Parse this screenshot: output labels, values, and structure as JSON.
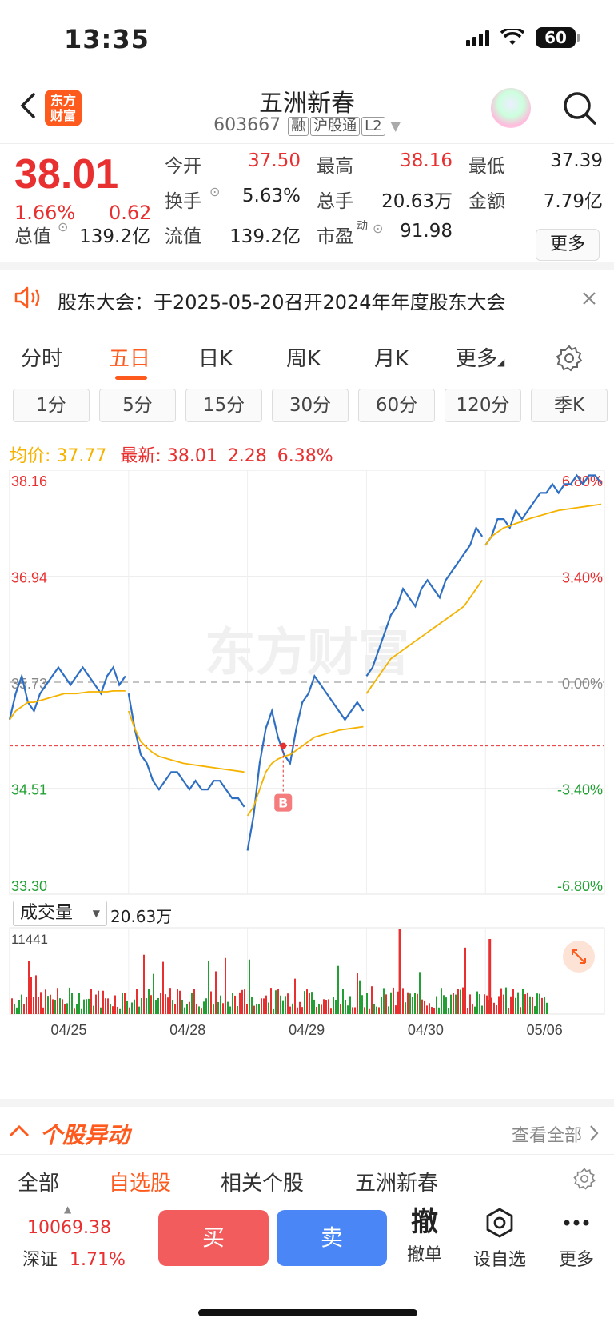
{
  "status": {
    "time": "13:35",
    "battery": "60"
  },
  "header": {
    "title": "五洲新春",
    "code": "603667",
    "tags": [
      "融",
      "沪股通",
      "L2"
    ],
    "logo_text": "东方财富"
  },
  "quote": {
    "price": "38.01",
    "pct": "1.66%",
    "change": "0.62",
    "open_label": "今开",
    "open": "37.50",
    "high_label": "最高",
    "high": "38.16",
    "low_label": "最低",
    "low": "37.39",
    "turnover_label": "换手",
    "turnover": "5.63%",
    "volume_label": "总手",
    "volume": "20.63万",
    "amount_label": "金额",
    "amount": "7.79亿",
    "mktcap_label": "总值",
    "mktcap": "139.2亿",
    "float_label": "流值",
    "float": "139.2亿",
    "pe_label": "市盈",
    "pe_sup": "动",
    "pe": "91.98",
    "more": "更多"
  },
  "notice": {
    "text": "股东大会：于2025-05-20召开2024年年度股东大会"
  },
  "tabs": [
    "分时",
    "五日",
    "日K",
    "周K",
    "月K",
    "更多"
  ],
  "subtabs": [
    "1分",
    "5分",
    "15分",
    "30分",
    "60分",
    "120分",
    "季K"
  ],
  "info": {
    "avg_label": "均价:",
    "avg": "37.77",
    "latest_label": "最新:",
    "latest": "38.01",
    "chg": "2.28",
    "pct": "6.38%"
  },
  "volume_panel": {
    "label": "成交量",
    "value": "20.63万",
    "max_label": "11441"
  },
  "chart_data": {
    "type": "line",
    "x": [
      "04/25",
      "04/28",
      "04/29",
      "04/30",
      "05/06"
    ],
    "y_labels_left": [
      "38.16",
      "36.94",
      "35.73",
      "34.51",
      "33.30"
    ],
    "y_labels_right": [
      "6.80%",
      "3.40%",
      "0.00%",
      "-3.40%",
      "-6.80%"
    ],
    "ylim": [
      33.3,
      38.16
    ],
    "prev_close": 35.73,
    "current_line": 35.0,
    "marker": "B",
    "series": [
      {
        "name": "价格",
        "color": "#2e6fc4",
        "days": [
          [
            35.3,
            35.6,
            35.8,
            35.5,
            35.4,
            35.6,
            35.7,
            35.8,
            35.9,
            35.8,
            35.7,
            35.8,
            35.9,
            35.8,
            35.7,
            35.6,
            35.8,
            35.9,
            35.7,
            35.8
          ],
          [
            35.6,
            35.2,
            34.9,
            34.8,
            34.6,
            34.5,
            34.6,
            34.7,
            34.7,
            34.6,
            34.5,
            34.6,
            34.5,
            34.5,
            34.6,
            34.6,
            34.5,
            34.4,
            34.4,
            34.3
          ],
          [
            33.8,
            34.2,
            34.8,
            35.2,
            35.4,
            35.1,
            34.9,
            34.8,
            35.2,
            35.5,
            35.6,
            35.8,
            35.7,
            35.6,
            35.5,
            35.4,
            35.3,
            35.4,
            35.5,
            35.4
          ],
          [
            35.8,
            35.9,
            36.1,
            36.3,
            36.5,
            36.6,
            36.8,
            36.7,
            36.6,
            36.8,
            36.9,
            36.8,
            36.7,
            36.9,
            37.0,
            37.1,
            37.2,
            37.3,
            37.5,
            37.4
          ],
          [
            37.3,
            37.4,
            37.6,
            37.6,
            37.5,
            37.7,
            37.6,
            37.7,
            37.8,
            37.9,
            37.9,
            38.0,
            37.9,
            38.0,
            38.0,
            38.1,
            38.0,
            38.1,
            38.1,
            38.01
          ]
        ]
      },
      {
        "name": "均价",
        "color": "#f5b300",
        "days": [
          [
            35.3,
            35.4,
            35.45,
            35.5,
            35.5,
            35.52,
            35.54,
            35.56,
            35.58,
            35.6,
            35.6,
            35.6,
            35.61,
            35.62,
            35.62,
            35.62,
            35.62,
            35.63,
            35.63,
            35.63
          ],
          [
            35.4,
            35.2,
            35.05,
            34.98,
            34.92,
            34.88,
            34.86,
            34.84,
            34.82,
            34.8,
            34.79,
            34.78,
            34.77,
            34.76,
            34.75,
            34.74,
            34.73,
            34.72,
            34.71,
            34.7
          ],
          [
            34.2,
            34.3,
            34.5,
            34.7,
            34.8,
            34.85,
            34.88,
            34.9,
            34.95,
            35.0,
            35.05,
            35.1,
            35.12,
            35.14,
            35.16,
            35.18,
            35.19,
            35.2,
            35.21,
            35.22
          ],
          [
            35.6,
            35.7,
            35.8,
            35.9,
            36.0,
            36.05,
            36.1,
            36.15,
            36.2,
            36.25,
            36.3,
            36.35,
            36.4,
            36.45,
            36.5,
            36.55,
            36.6,
            36.7,
            36.8,
            36.9
          ],
          [
            37.3,
            37.4,
            37.45,
            37.5,
            37.52,
            37.55,
            37.57,
            37.6,
            37.62,
            37.64,
            37.66,
            37.68,
            37.7,
            37.71,
            37.72,
            37.73,
            37.74,
            37.75,
            37.76,
            37.77
          ]
        ]
      }
    ]
  },
  "yidong": {
    "title": "个股异动",
    "all": "查看全部"
  },
  "feed_tabs": [
    "全部",
    "自选股",
    "相关个股",
    "五洲新春"
  ],
  "bottom": {
    "index_value": "10069.38",
    "index_name": "深证",
    "index_pct": "1.71%",
    "buy": "买",
    "sell": "卖",
    "cancel_icon": "撤",
    "cancel": "撤单",
    "watch": "设自选",
    "more": "更多"
  }
}
